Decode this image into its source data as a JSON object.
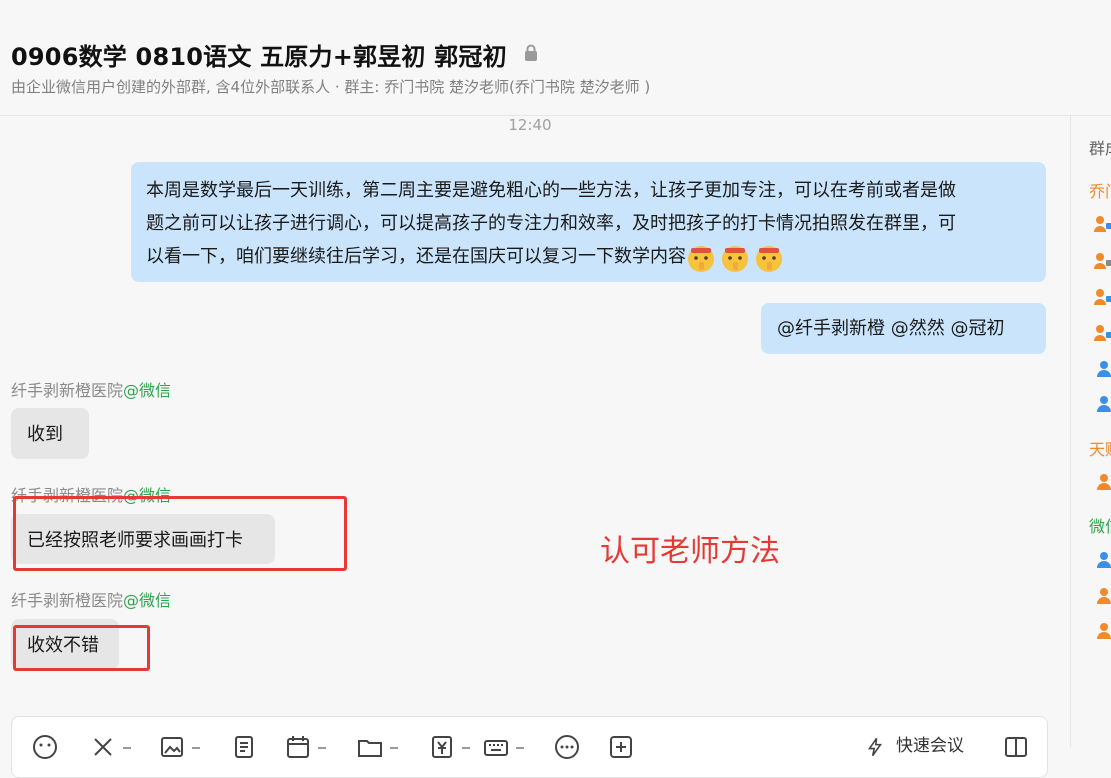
{
  "header": {
    "title": "0906数学  0810语文  五原力+郭昱初 郭冠初",
    "subtitle": "由企业微信用户创建的外部群, 含4位外部联系人 · 群主: 乔门书院 楚汐老师(乔门书院 楚汐老师 )"
  },
  "chat": {
    "timestamp": "12:40",
    "messages": [
      {
        "text_line1": "本周是数学最后一天训练，第二周主要是避免粗心的一些方法，让孩子更加专注，可以在考前或者是做",
        "text_line2": "题之前可以让孩子进行调心，可以提高孩子的专注力和效率，及时把孩子的打卡情况拍照发在群里，可",
        "text_line3": "以看一下，咱们要继续往后学习，还是在国庆可以复习一下数学内容"
      },
      {
        "text": "@纤手剥新橙 @然然 @冠初"
      }
    ],
    "received": [
      {
        "sender": "纤手剥新橙医院",
        "tag": "@微信",
        "text": "收到"
      },
      {
        "sender": "纤手剥新橙医院",
        "tag": "@微信",
        "text": "已经按照老师要求画画打卡"
      },
      {
        "sender": "纤手剥新橙医院",
        "tag": "@微信",
        "text": "收效不错"
      }
    ]
  },
  "annotation": "认可老师方法",
  "toolbar": {
    "meeting_label": "快速会议"
  },
  "right_panel": {
    "title": "群成",
    "groups": [
      "乔门",
      "天赐",
      "微信"
    ]
  },
  "colors": {
    "bubble_self": "#c9e4fb",
    "bubble_other": "#e6e6e6",
    "wechat_green": "#2fa44f",
    "annotation_red": "#e53935",
    "group_orange": "#f08a2c"
  }
}
